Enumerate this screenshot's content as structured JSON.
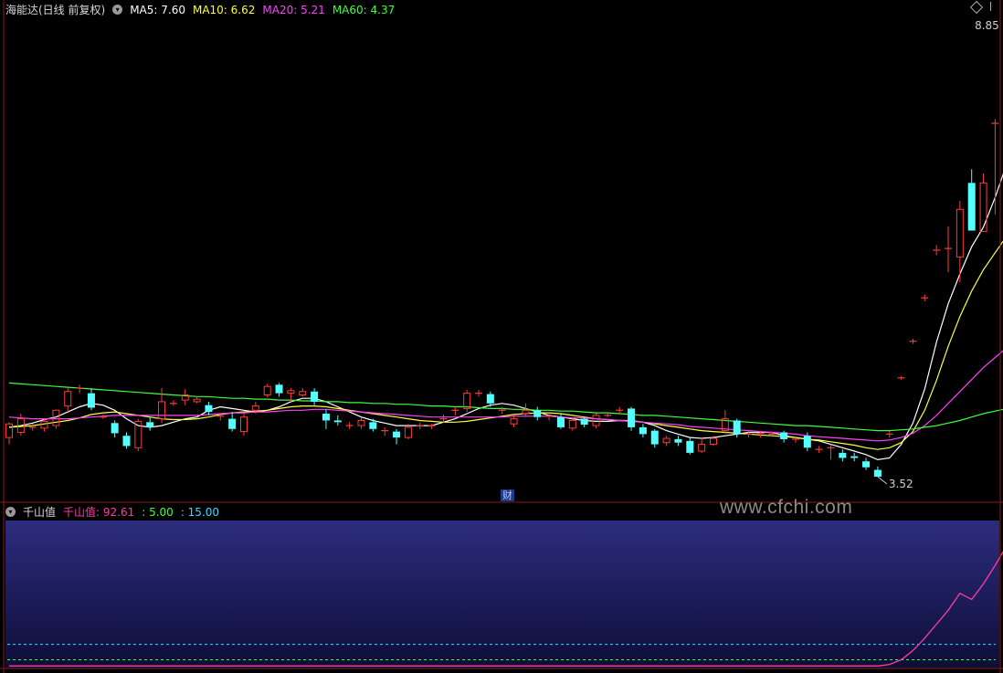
{
  "top_legend": {
    "title": "海能达(日线 前复权)",
    "ma5": "MA5: 7.60",
    "ma10": "MA10: 6.62",
    "ma20": "MA20: 5.21",
    "ma60": "MA60: 4.37",
    "colors": {
      "title": "#d8d8d8",
      "ma5": "#ffffff",
      "ma10": "#ffff3a",
      "ma20": "#ff40ff",
      "ma60": "#3cff3c"
    }
  },
  "bottom_legend": {
    "title": "千山值",
    "main": "千山值: 92.61",
    "level1": ": 5.00",
    "level2": ": 15.00",
    "colors": {
      "title": "#d8d8d8",
      "main": "#ff3ca0",
      "level1": "#3cff3c",
      "level2": "#3cd8ff"
    }
  },
  "annotations": {
    "high_label": "8.85",
    "low_label": "3.52",
    "finance_badge": "财"
  },
  "watermark": "www.cfchi.com",
  "chart_data": [
    {
      "type": "candlestick",
      "title": "海能达(日线 前复权)",
      "ylim": [
        3.0,
        9.3
      ],
      "up_color": "#ff3a3a",
      "down_color": "#54ffff",
      "candles": [
        [
          3.98,
          4.14,
          4.16,
          3.9
        ],
        [
          4.04,
          4.2,
          4.26,
          4.0
        ],
        [
          4.1,
          4.1,
          4.14,
          4.06
        ],
        [
          4.09,
          4.17,
          4.2,
          4.05
        ],
        [
          4.12,
          4.3,
          4.31,
          4.08
        ],
        [
          4.35,
          4.52,
          4.56,
          4.28
        ],
        [
          4.56,
          4.56,
          4.6,
          4.5
        ],
        [
          4.5,
          4.33,
          4.56,
          4.3
        ],
        [
          4.22,
          4.22,
          4.25,
          4.2
        ],
        [
          4.15,
          4.03,
          4.18,
          3.98
        ],
        [
          4.0,
          3.88,
          4.04,
          3.85
        ],
        [
          3.86,
          4.17,
          4.2,
          3.82
        ],
        [
          4.16,
          4.1,
          4.22,
          4.06
        ],
        [
          4.2,
          4.4,
          4.56,
          4.15
        ],
        [
          4.38,
          4.38,
          4.42,
          4.35
        ],
        [
          4.42,
          4.48,
          4.55,
          4.36
        ],
        [
          4.4,
          4.43,
          4.46,
          4.38
        ],
        [
          4.36,
          4.28,
          4.4,
          4.24
        ],
        [
          4.22,
          4.23,
          4.26,
          4.18
        ],
        [
          4.2,
          4.08,
          4.28,
          4.05
        ],
        [
          4.05,
          4.22,
          4.26,
          4.0
        ],
        [
          4.3,
          4.35,
          4.4,
          4.26
        ],
        [
          4.48,
          4.58,
          4.61,
          4.45
        ],
        [
          4.6,
          4.5,
          4.62,
          4.46
        ],
        [
          4.5,
          4.53,
          4.56,
          4.4
        ],
        [
          4.48,
          4.52,
          4.56,
          4.46
        ],
        [
          4.52,
          4.4,
          4.56,
          4.36
        ],
        [
          4.26,
          4.18,
          4.31,
          4.08
        ],
        [
          4.18,
          4.16,
          4.24,
          4.12
        ],
        [
          4.12,
          4.12,
          4.16,
          4.08
        ],
        [
          4.12,
          4.18,
          4.22,
          4.08
        ],
        [
          4.16,
          4.08,
          4.2,
          4.05
        ],
        [
          4.06,
          4.06,
          4.1,
          4.0
        ],
        [
          4.05,
          3.98,
          4.08,
          3.9
        ],
        [
          3.98,
          4.1,
          4.14,
          3.96
        ],
        [
          4.12,
          4.12,
          4.16,
          4.08
        ],
        [
          4.12,
          4.12,
          4.14,
          4.08
        ],
        [
          4.2,
          4.2,
          4.25,
          4.15
        ],
        [
          4.3,
          4.3,
          4.34,
          4.24
        ],
        [
          4.32,
          4.5,
          4.54,
          4.28
        ],
        [
          4.5,
          4.5,
          4.54,
          4.46
        ],
        [
          4.49,
          4.38,
          4.52,
          4.34
        ],
        [
          4.3,
          4.3,
          4.34,
          4.26
        ],
        [
          4.14,
          4.2,
          4.24,
          4.1
        ],
        [
          4.26,
          4.3,
          4.38,
          4.22
        ],
        [
          4.3,
          4.22,
          4.34,
          4.18
        ],
        [
          4.22,
          4.23,
          4.25,
          4.18
        ],
        [
          4.22,
          4.1,
          4.26,
          4.08
        ],
        [
          4.09,
          4.18,
          4.21,
          4.06
        ],
        [
          4.2,
          4.13,
          4.22,
          4.1
        ],
        [
          4.12,
          4.24,
          4.26,
          4.09
        ],
        [
          4.24,
          4.24,
          4.26,
          4.22
        ],
        [
          4.3,
          4.3,
          4.34,
          4.26
        ],
        [
          4.32,
          4.1,
          4.34,
          4.06
        ],
        [
          4.1,
          4.02,
          4.14,
          3.98
        ],
        [
          4.06,
          3.9,
          4.08,
          3.86
        ],
        [
          3.92,
          3.97,
          4.0,
          3.88
        ],
        [
          3.96,
          3.92,
          4.0,
          3.88
        ],
        [
          3.94,
          3.8,
          3.98,
          3.78
        ],
        [
          3.82,
          3.9,
          3.98,
          3.8
        ],
        [
          3.9,
          3.97,
          4.0,
          3.88
        ],
        [
          4.06,
          4.2,
          4.3,
          4.02
        ],
        [
          4.18,
          4.02,
          4.2,
          3.98
        ],
        [
          4.02,
          4.02,
          4.06,
          3.98
        ],
        [
          4.02,
          4.03,
          4.06,
          3.98
        ],
        [
          4.02,
          4.02,
          4.04,
          4.0
        ],
        [
          4.04,
          3.96,
          4.06,
          3.92
        ],
        [
          3.96,
          3.96,
          3.98,
          3.92
        ],
        [
          4.0,
          3.86,
          4.04,
          3.82
        ],
        [
          3.84,
          3.84,
          3.88,
          3.8
        ],
        [
          3.86,
          3.86,
          3.9,
          3.72
        ],
        [
          3.8,
          3.74,
          3.84,
          3.7
        ],
        [
          3.76,
          3.74,
          3.8,
          3.7
        ],
        [
          3.7,
          3.63,
          3.74,
          3.6
        ],
        [
          3.6,
          3.52,
          3.64,
          3.52
        ],
        [
          4.02,
          4.02,
          4.06,
          3.98
        ],
        [
          4.68,
          4.68,
          4.7,
          4.66
        ],
        [
          5.11,
          5.11,
          5.14,
          5.08
        ],
        [
          5.62,
          5.62,
          5.66,
          5.58
        ],
        [
          6.17,
          6.18,
          6.24,
          6.12
        ],
        [
          6.2,
          6.2,
          6.46,
          5.92
        ],
        [
          6.1,
          6.66,
          6.76,
          5.8
        ],
        [
          6.97,
          6.41,
          7.13,
          6.41
        ],
        [
          6.4,
          6.97,
          7.08,
          6.4
        ],
        [
          7.67,
          7.67,
          7.72,
          6.6
        ],
        [
          7.52,
          8.24,
          8.49,
          7.45
        ],
        [
          8.68,
          7.61,
          8.85,
          7.45
        ],
        [
          8.24,
          8.68,
          8.72,
          8.24
        ]
      ],
      "series": [
        {
          "name": "MA5",
          "color": "#ffffff",
          "values": [
            4.1,
            4.12,
            4.15,
            4.19,
            4.22,
            4.28,
            4.34,
            4.38,
            4.36,
            4.3,
            4.2,
            4.12,
            4.1,
            4.12,
            4.16,
            4.2,
            4.22,
            4.3,
            4.34,
            4.32,
            4.3,
            4.28,
            4.3,
            4.34,
            4.4,
            4.44,
            4.44,
            4.4,
            4.34,
            4.28,
            4.22,
            4.18,
            4.15,
            4.12,
            4.12,
            4.12,
            4.12,
            4.16,
            4.2,
            4.26,
            4.32,
            4.36,
            4.38,
            4.36,
            4.32,
            4.28,
            4.24,
            4.22,
            4.2,
            4.18,
            4.17,
            4.17,
            4.18,
            4.18,
            4.16,
            4.12,
            4.06,
            4.02,
            3.98,
            3.97,
            3.98,
            4.0,
            4.02,
            4.04,
            4.04,
            4.04,
            4.0,
            3.98,
            3.96,
            3.94,
            3.9,
            3.86,
            3.82,
            3.78,
            3.72,
            3.74,
            3.9,
            4.15,
            4.55,
            5.1,
            5.55,
            5.9,
            6.22,
            6.45,
            6.8,
            7.2,
            7.45,
            7.6
          ]
        },
        {
          "name": "MA10",
          "color": "#ffff3a",
          "values": [
            4.1,
            4.11,
            4.12,
            4.14,
            4.16,
            4.18,
            4.21,
            4.25,
            4.27,
            4.28,
            4.26,
            4.24,
            4.22,
            4.2,
            4.19,
            4.19,
            4.2,
            4.22,
            4.25,
            4.27,
            4.28,
            4.29,
            4.3,
            4.32,
            4.34,
            4.35,
            4.35,
            4.34,
            4.32,
            4.3,
            4.28,
            4.26,
            4.24,
            4.22,
            4.2,
            4.18,
            4.17,
            4.16,
            4.16,
            4.17,
            4.19,
            4.21,
            4.23,
            4.25,
            4.26,
            4.27,
            4.27,
            4.26,
            4.24,
            4.22,
            4.2,
            4.19,
            4.18,
            4.17,
            4.16,
            4.14,
            4.12,
            4.1,
            4.08,
            4.06,
            4.05,
            4.04,
            4.03,
            4.02,
            4.01,
            4.0,
            3.99,
            3.98,
            3.96,
            3.95,
            3.93,
            3.91,
            3.89,
            3.86,
            3.84,
            3.86,
            3.92,
            4.05,
            4.3,
            4.65,
            5.05,
            5.4,
            5.7,
            5.95,
            6.15,
            6.35,
            6.52,
            6.62
          ]
        },
        {
          "name": "MA20",
          "color": "#ff40ff",
          "values": [
            4.22,
            4.21,
            4.2,
            4.2,
            4.2,
            4.2,
            4.21,
            4.22,
            4.23,
            4.24,
            4.24,
            4.24,
            4.24,
            4.24,
            4.24,
            4.24,
            4.24,
            4.25,
            4.26,
            4.27,
            4.27,
            4.28,
            4.28,
            4.29,
            4.3,
            4.3,
            4.31,
            4.31,
            4.3,
            4.29,
            4.28,
            4.27,
            4.26,
            4.25,
            4.24,
            4.23,
            4.22,
            4.22,
            4.22,
            4.22,
            4.22,
            4.22,
            4.22,
            4.23,
            4.23,
            4.23,
            4.23,
            4.22,
            4.21,
            4.21,
            4.2,
            4.19,
            4.18,
            4.17,
            4.16,
            4.15,
            4.14,
            4.13,
            4.11,
            4.1,
            4.09,
            4.08,
            4.07,
            4.06,
            4.05,
            4.04,
            4.03,
            4.02,
            4.0,
            3.99,
            3.98,
            3.97,
            3.96,
            3.95,
            3.94,
            3.95,
            3.98,
            4.03,
            4.12,
            4.24,
            4.38,
            4.52,
            4.66,
            4.8,
            4.92,
            5.04,
            5.14,
            5.21
          ]
        },
        {
          "name": "MA60",
          "color": "#3cff3c",
          "values": [
            4.62,
            4.61,
            4.6,
            4.59,
            4.58,
            4.57,
            4.56,
            4.55,
            4.54,
            4.53,
            4.52,
            4.51,
            4.5,
            4.49,
            4.48,
            4.47,
            4.46,
            4.46,
            4.45,
            4.44,
            4.44,
            4.43,
            4.43,
            4.42,
            4.42,
            4.41,
            4.41,
            4.4,
            4.4,
            4.39,
            4.39,
            4.38,
            4.38,
            4.37,
            4.37,
            4.36,
            4.35,
            4.35,
            4.34,
            4.34,
            4.33,
            4.32,
            4.32,
            4.31,
            4.31,
            4.3,
            4.3,
            4.29,
            4.29,
            4.28,
            4.27,
            4.27,
            4.26,
            4.25,
            4.24,
            4.24,
            4.23,
            4.22,
            4.21,
            4.2,
            4.19,
            4.18,
            4.17,
            4.16,
            4.15,
            4.14,
            4.13,
            4.12,
            4.12,
            4.11,
            4.1,
            4.09,
            4.08,
            4.07,
            4.06,
            4.06,
            4.07,
            4.08,
            4.1,
            4.12,
            4.15,
            4.18,
            4.22,
            4.26,
            4.29,
            4.32,
            4.35,
            4.37
          ]
        }
      ],
      "annotations": [
        {
          "label": "8.85",
          "type": "high"
        },
        {
          "label": "3.52",
          "type": "low"
        }
      ]
    },
    {
      "type": "line",
      "title": "千山值",
      "ylim": [
        0,
        95
      ],
      "background": "gradient #2a2a7a -> #10103a",
      "series": [
        {
          "name": "千山值",
          "color": "#ff3ca0",
          "values": [
            1,
            1,
            1,
            1,
            1,
            1,
            1,
            1,
            1,
            1,
            1,
            1,
            1,
            1,
            1,
            1,
            1,
            1,
            1,
            1,
            1,
            1,
            1,
            1,
            1,
            1,
            1,
            1,
            1,
            1,
            1,
            1,
            1,
            1,
            1,
            1,
            1,
            1,
            1,
            1,
            1,
            1,
            1,
            1,
            1,
            1,
            1,
            1,
            1,
            1,
            1,
            1,
            1,
            1,
            1,
            1,
            1,
            1,
            1,
            1,
            1,
            1,
            1,
            1,
            1,
            1,
            1,
            1,
            1,
            1,
            1,
            1,
            1,
            1,
            1,
            2,
            5,
            11,
            19,
            28,
            37,
            48,
            44,
            54,
            66,
            79,
            72,
            92.61
          ]
        }
      ],
      "reference_lines": [
        {
          "name": "5.00",
          "value": 5.0,
          "color": "#3cff3c",
          "dashed": true
        },
        {
          "name": "15.00",
          "value": 15.0,
          "color": "#3cd8ff",
          "dashed": true
        }
      ]
    }
  ]
}
